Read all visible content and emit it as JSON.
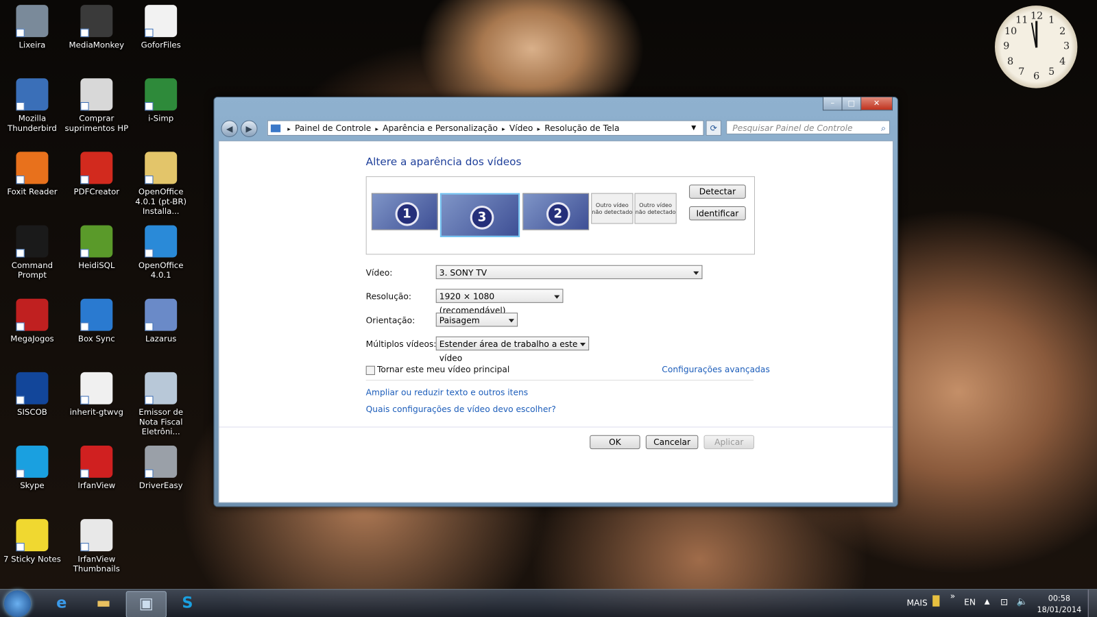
{
  "desktop_icons": [
    {
      "label": "Lixeira",
      "color": "#7a8a9a"
    },
    {
      "label": "MediaMonkey",
      "color": "#3a3a3a"
    },
    {
      "label": "GoforFiles",
      "color": "#f2f2f2"
    },
    {
      "label": "Mozilla Thunderbird",
      "color": "#3a6fb8"
    },
    {
      "label": "Comprar suprimentos HP",
      "color": "#d8d8d8"
    },
    {
      "label": "i-Simp",
      "color": "#2e8a3a"
    },
    {
      "label": "Foxit Reader",
      "color": "#e8711c"
    },
    {
      "label": "PDFCreator",
      "color": "#d22a1e"
    },
    {
      "label": "OpenOffice 4.0.1 (pt-BR) Installa...",
      "color": "#e3c56a"
    },
    {
      "label": "Command Prompt",
      "color": "#1a1a1a"
    },
    {
      "label": "HeidiSQL",
      "color": "#5a9a2a"
    },
    {
      "label": "OpenOffice 4.0.1",
      "color": "#2a8ad8"
    },
    {
      "label": "MegaJogos",
      "color": "#c02020"
    },
    {
      "label": "Box Sync",
      "color": "#2a7ad0"
    },
    {
      "label": "Lazarus",
      "color": "#6a8ac8"
    },
    {
      "label": "SISCOB",
      "color": "#12469a"
    },
    {
      "label": "inherit-gtwvg",
      "color": "#f0f0f0"
    },
    {
      "label": "Emissor de Nota Fiscal Eletrôni...",
      "color": "#b8c8d8"
    },
    {
      "label": "Skype",
      "color": "#1aa0e0"
    },
    {
      "label": "IrfanView",
      "color": "#d02020"
    },
    {
      "label": "DriverEasy",
      "color": "#9aa0a8"
    },
    {
      "label": "7 Sticky Notes",
      "color": "#f0d830"
    },
    {
      "label": "IrfanView Thumbnails",
      "color": "#e8e8e8"
    }
  ],
  "window": {
    "controls": {
      "minimize": "–",
      "maximize": "□",
      "close": "✕"
    },
    "breadcrumb": [
      "Painel de Controle",
      "Aparência e Personalização",
      "Vídeo",
      "Resolução de Tela"
    ],
    "search_placeholder": "Pesquisar Painel de Controle",
    "title": "Altere a aparência dos vídeos",
    "monitors": [
      {
        "number": "1"
      },
      {
        "number": "3",
        "selected": true
      },
      {
        "number": "2"
      }
    ],
    "not_detected": [
      "Outro vídeo não detectado",
      "Outro vídeo não detectado"
    ],
    "detect": "Detectar",
    "identify": "Identificar",
    "fields": {
      "video": {
        "label": "Vídeo:",
        "value": "3. SONY TV"
      },
      "resolution": {
        "label": "Resolução:",
        "value": "1920 × 1080 (recomendável)"
      },
      "orientation": {
        "label": "Orientação:",
        "value": "Paisagem"
      },
      "multiple": {
        "label": "Múltiplos vídeos:",
        "value": "Estender área de trabalho a este vídeo"
      }
    },
    "primary_checkbox": {
      "label": "Tornar este meu vídeo principal",
      "checked": false
    },
    "advanced_link": "Configurações avançadas",
    "links": [
      "Ampliar ou reduzir texto e outros itens",
      "Quais configurações de vídeo devo escolher?"
    ],
    "ok": "OK",
    "cancel": "Cancelar",
    "apply": "Aplicar"
  },
  "clock_numbers": [
    "12",
    "1",
    "2",
    "3",
    "4",
    "5",
    "6",
    "7",
    "8",
    "9",
    "10",
    "11"
  ],
  "taskbar": {
    "more": "MAIS",
    "overflow": "»",
    "language": "EN",
    "time": "00:58",
    "date": "18/01/2014"
  }
}
